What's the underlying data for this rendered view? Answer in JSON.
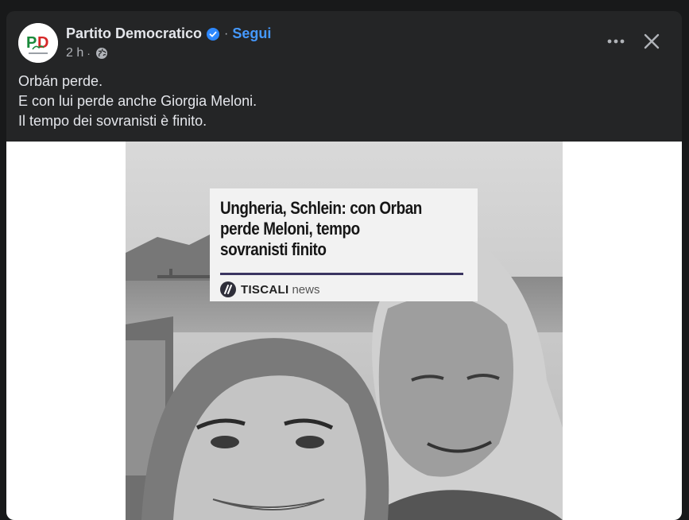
{
  "post": {
    "page_name": "Partito Democratico",
    "follow_label": "Segui",
    "separator": "·",
    "timestamp": "2 h",
    "privacy_icon": "globe-icon",
    "text_lines": [
      "Orbán perde.",
      "E con lui perde anche Giorgia Meloni.",
      "Il tempo dei sovranisti è finito."
    ]
  },
  "media": {
    "headline_lines": [
      "Ungheria, Schlein: con Orban",
      "perde Meloni, tempo",
      "sovranisti finito"
    ],
    "source_name": "TISCALI",
    "source_suffix": "news"
  },
  "icons": {
    "verified": "verified-badge-icon",
    "more": "more-icon",
    "close": "close-icon"
  },
  "colors": {
    "background": "#18191a",
    "card": "#242526",
    "link_blue": "#4599ff",
    "verified_blue": "#2d88ff",
    "text_primary": "#e4e6eb",
    "text_secondary": "#b0b3b8"
  }
}
